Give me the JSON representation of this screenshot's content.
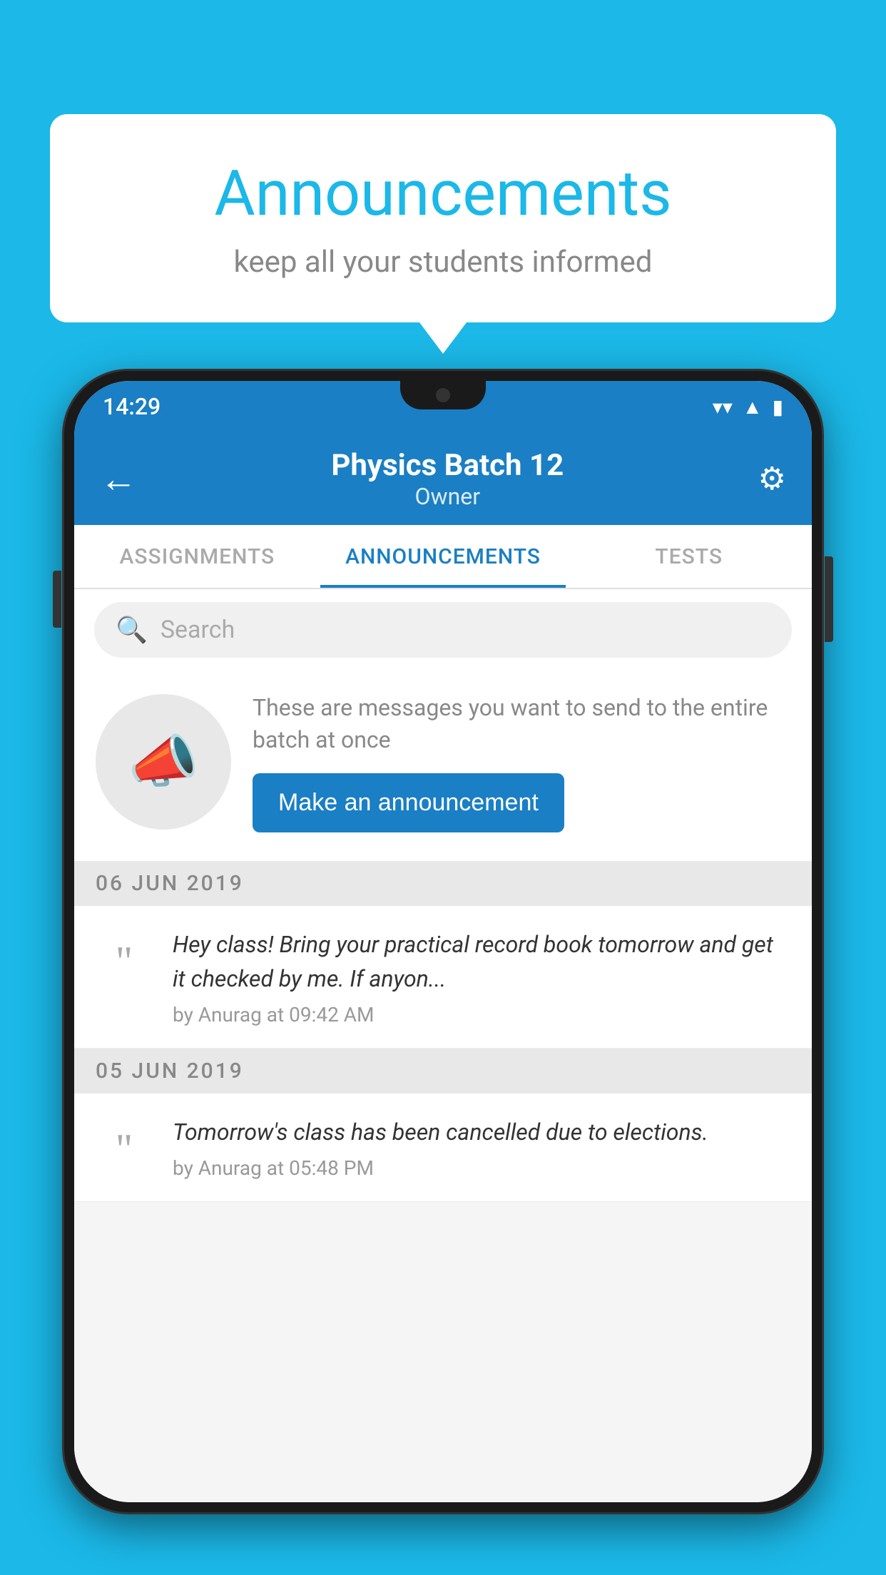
{
  "background_color": "#1bb8e8",
  "speech_bubble": {
    "title": "Announcements",
    "subtitle": "keep all your students informed"
  },
  "status_bar": {
    "time": "14:29"
  },
  "app_bar": {
    "title": "Physics Batch 12",
    "subtitle": "Owner",
    "back_label": "←",
    "settings_label": "⚙"
  },
  "tabs": [
    {
      "label": "ASSIGNMENTS",
      "active": false
    },
    {
      "label": "ANNOUNCEMENTS",
      "active": true
    },
    {
      "label": "TESTS",
      "active": false
    }
  ],
  "search": {
    "placeholder": "Search"
  },
  "promo": {
    "text": "These are messages you want to send to the entire batch at once",
    "button_label": "Make an announcement"
  },
  "announcements": [
    {
      "date": "06  JUN  2019",
      "message": "Hey class! Bring your practical record book tomorrow and get it checked by me. If anyon...",
      "meta": "by Anurag at 09:42 AM"
    },
    {
      "date": "05  JUN  2019",
      "message": "Tomorrow's class has been cancelled due to elections.",
      "meta": "by Anurag at 05:48 PM"
    }
  ]
}
